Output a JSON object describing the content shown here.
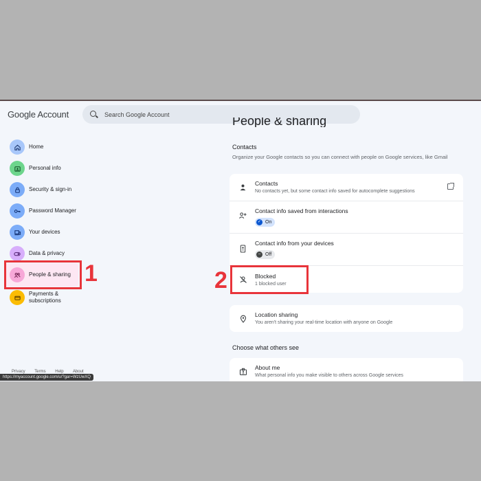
{
  "header": {
    "brand": "Google Account",
    "search_placeholder": "Search Google Account"
  },
  "sidebar": {
    "items": [
      {
        "label": "Home",
        "icon": "home-icon",
        "color": "#a8c7fa"
      },
      {
        "label": "Personal info",
        "icon": "id-card-icon",
        "color": "#6dd58c"
      },
      {
        "label": "Security & sign-in",
        "icon": "lock-icon",
        "color": "#7cacf8"
      },
      {
        "label": "Password Manager",
        "icon": "key-icon",
        "color": "#7cacf8"
      },
      {
        "label": "Your devices",
        "icon": "devices-icon",
        "color": "#7cacf8"
      },
      {
        "label": "Data & privacy",
        "icon": "toggle-icon",
        "color": "#d7aefb"
      },
      {
        "label": "People & sharing",
        "icon": "people-icon",
        "color": "#f7a8d8"
      },
      {
        "label": "Payments & subscriptions",
        "icon": "wallet-icon",
        "color": "#fbbc04"
      }
    ],
    "footer_links": [
      "Privacy",
      "Terms",
      "Help",
      "About"
    ],
    "url_tooltip": "https://myaccount.google.com/u/?gar=WzUwXQ"
  },
  "main": {
    "page_title": "People & sharing",
    "contacts_heading": "Contacts",
    "contacts_desc": "Organize your Google contacts so you can connect with people on Google services, like Gmail",
    "contacts_rows": [
      {
        "title": "Contacts",
        "subtitle": "No contacts yet, but some contact info saved for autocomplete suggestions",
        "icon": "person-icon"
      },
      {
        "title": "Contact info saved from interactions",
        "chip": "On",
        "icon": "person-add-icon"
      },
      {
        "title": "Contact info from your devices",
        "chip": "Off",
        "icon": "contact-device-icon"
      },
      {
        "title": "Blocked",
        "subtitle": "1 blocked user",
        "icon": "blocked-person-icon"
      }
    ],
    "location": {
      "title": "Location sharing",
      "subtitle": "You aren't sharing your real-time location with anyone on Google",
      "icon": "location-icon"
    },
    "others_heading": "Choose what others see",
    "about": {
      "title": "About me",
      "subtitle": "What personal info you make visible to others across Google services",
      "icon": "badge-icon"
    }
  },
  "annotations": {
    "step1": "1",
    "step2": "2"
  }
}
